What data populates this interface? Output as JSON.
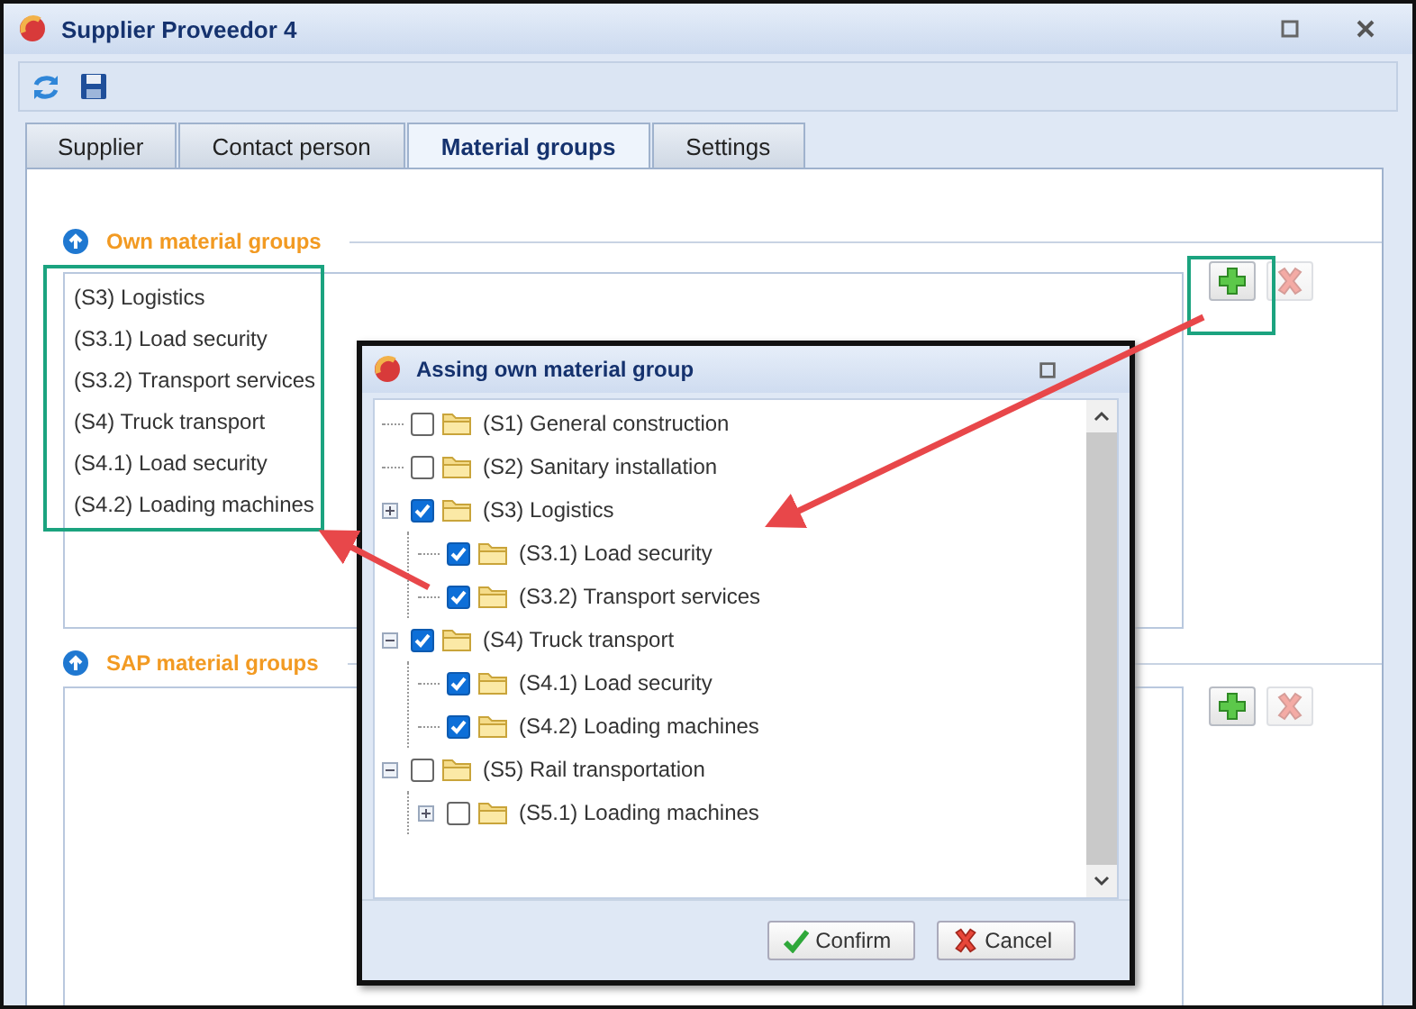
{
  "window": {
    "title": "Supplier Proveedor 4"
  },
  "tabs": [
    {
      "label": "Supplier",
      "selected": false
    },
    {
      "label": "Contact person",
      "selected": false
    },
    {
      "label": "Material groups",
      "selected": true
    },
    {
      "label": "Settings",
      "selected": false
    }
  ],
  "own_material_groups": {
    "title": "Own material groups",
    "items": [
      "(S3) Logistics",
      "(S3.1) Load security",
      "(S3.2) Transport services",
      "(S4) Truck transport",
      "(S4.1) Load security",
      "(S4.2) Loading machines"
    ],
    "add_disabled": false,
    "remove_disabled": true
  },
  "sap_material_groups": {
    "title": "SAP material groups",
    "add_disabled": false,
    "remove_disabled": true
  },
  "dialog": {
    "title": "Assing own material group",
    "tree": [
      {
        "label": "(S1) General construction",
        "checked": false
      },
      {
        "label": "(S2) Sanitary installation",
        "checked": false
      },
      {
        "label": "(S3) Logistics",
        "checked": true,
        "expanded": false,
        "children": [
          {
            "label": "(S3.1) Load security",
            "checked": true
          },
          {
            "label": "(S3.2) Transport services",
            "checked": true
          }
        ]
      },
      {
        "label": "(S4) Truck transport",
        "checked": true,
        "expanded": true,
        "children": [
          {
            "label": "(S4.1) Load security",
            "checked": true
          },
          {
            "label": "(S4.2) Loading machines",
            "checked": true
          }
        ]
      },
      {
        "label": "(S5) Rail transportation",
        "checked": false,
        "expanded": true,
        "children": [
          {
            "label": "(S5.1) Loading machines",
            "checked": false,
            "expanded": false
          }
        ]
      }
    ],
    "buttons": [
      {
        "kind": "confirm",
        "label": "Confirm"
      },
      {
        "kind": "cancel",
        "label": "Cancel"
      }
    ]
  }
}
